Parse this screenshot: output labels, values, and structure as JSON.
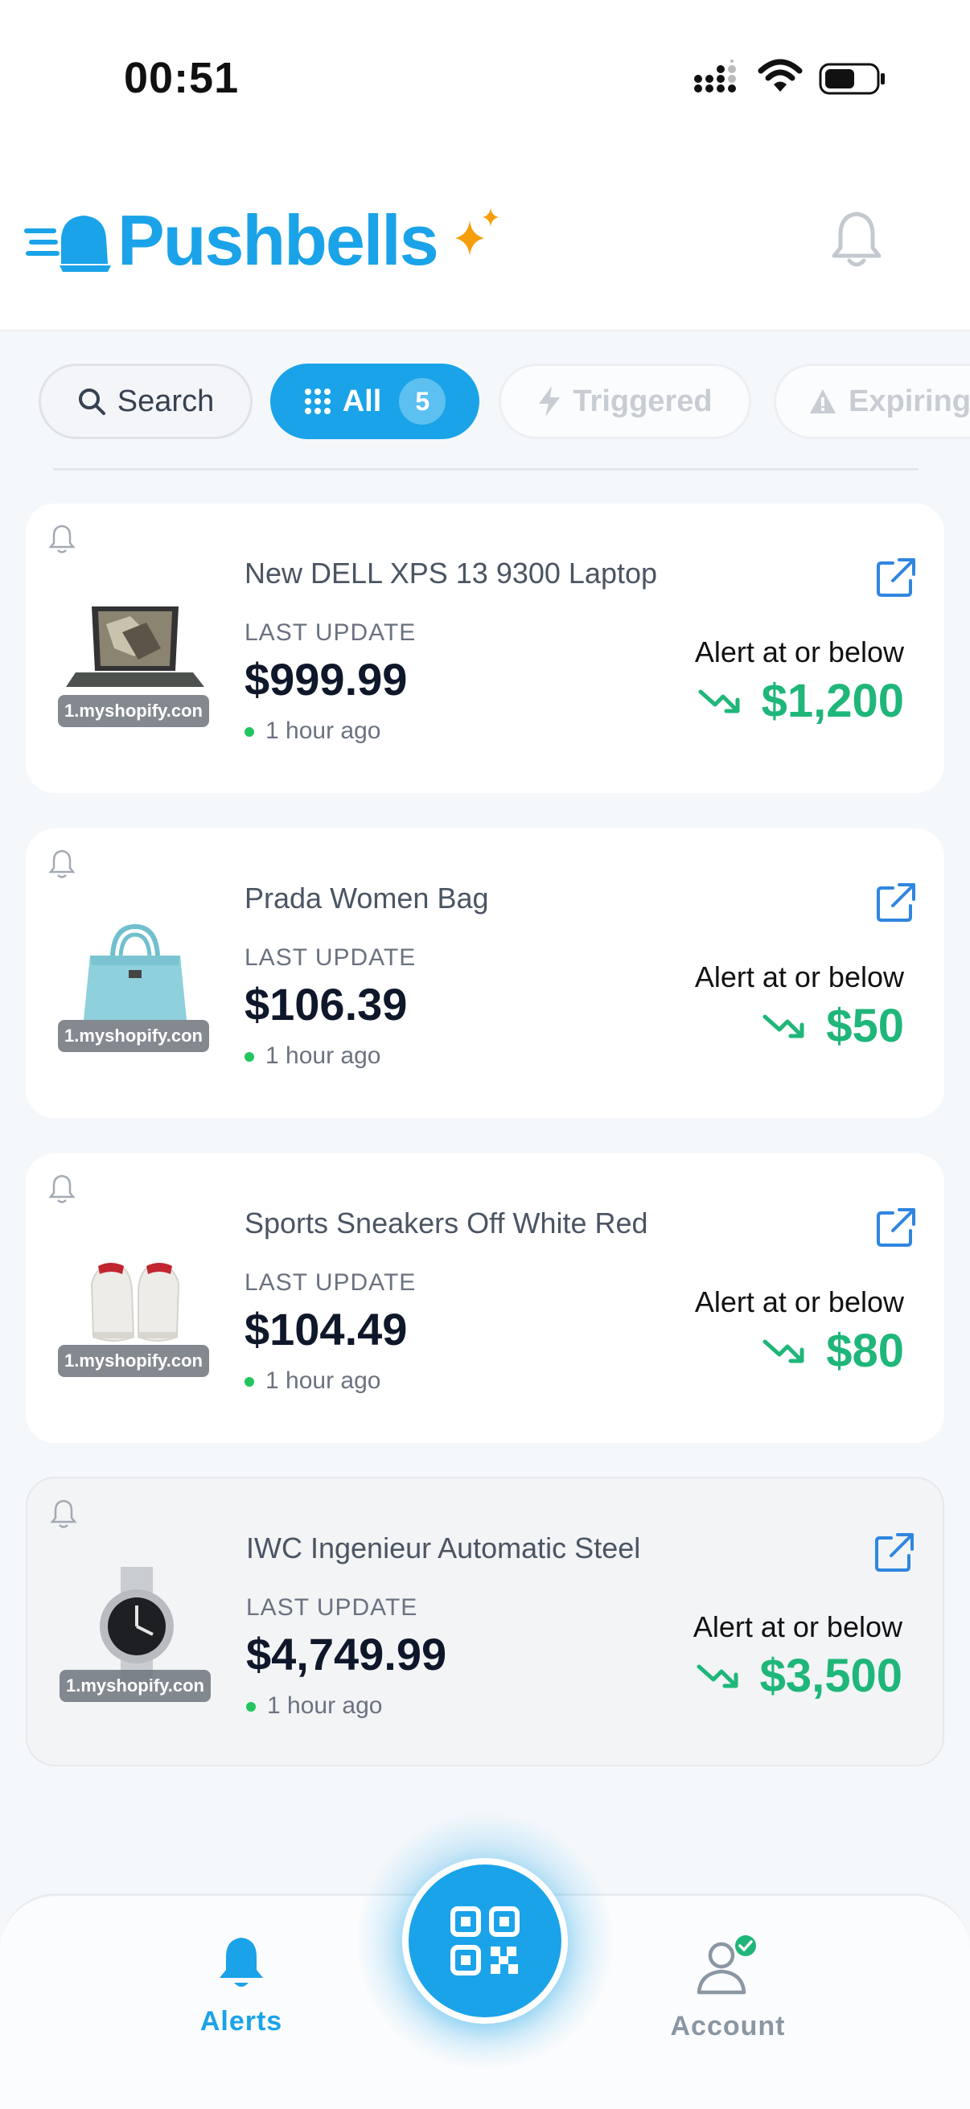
{
  "status_bar": {
    "time": "00:51"
  },
  "header": {
    "brand": "Pushbells"
  },
  "filters": {
    "search_label": "Search",
    "all_label": "All",
    "all_count": "5",
    "triggered_label": "Triggered",
    "expiring_label": "Expiring"
  },
  "alerts": [
    {
      "title": "New DELL XPS 13 9300 Laptop",
      "last_update_label": "LAST UPDATE",
      "price": "$999.99",
      "updated": "1 hour ago",
      "store": "1.myshopify.con",
      "alert_label": "Alert at or below",
      "target": "$1,200"
    },
    {
      "title": "Prada Women Bag",
      "last_update_label": "LAST UPDATE",
      "price": "$106.39",
      "updated": "1 hour ago",
      "store": "1.myshopify.con",
      "alert_label": "Alert at or below",
      "target": "$50"
    },
    {
      "title": "Sports Sneakers Off White Red",
      "last_update_label": "LAST UPDATE",
      "price": "$104.49",
      "updated": "1 hour ago",
      "store": "1.myshopify.con",
      "alert_label": "Alert at or below",
      "target": "$80"
    },
    {
      "title": "IWC Ingenieur Automatic Steel",
      "last_update_label": "LAST UPDATE",
      "price": "$4,749.99",
      "updated": "1 hour ago",
      "store": "1.myshopify.con",
      "alert_label": "Alert at or below",
      "target": "$3,500"
    }
  ],
  "nav": {
    "alerts_label": "Alerts",
    "account_label": "Account"
  },
  "colors": {
    "accent": "#1aa3e8",
    "target_green": "#1fb67a",
    "active_nav": "#1aa3e8",
    "inactive_nav": "#8a96a3"
  }
}
